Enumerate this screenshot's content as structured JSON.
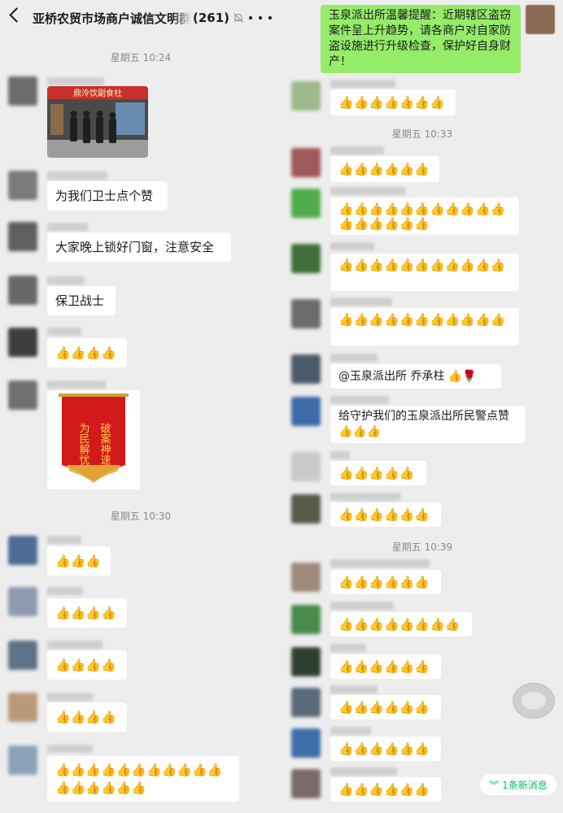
{
  "header": {
    "title": "亚桥农贸市场商户诚信文明群",
    "count": "(261)",
    "icons": {
      "back": "back-chevron-icon",
      "mute": "mute-bell-icon",
      "more": "more-dots-icon"
    }
  },
  "times": {
    "left_1": "星期五 10:24",
    "left_2": "星期五 10:30",
    "right_1": "星期五 10:33",
    "right_2": "星期五 10:39"
  },
  "messages_left": {
    "m1_image": "police-photo",
    "m2": "为我们卫士点个赞",
    "m3": "大家晚上锁好门窗，注意安全",
    "m4": "保卫战士",
    "m5": "👍👍👍👍",
    "m6_image": "banner-photo",
    "m7": "👍👍👍",
    "m8": "👍👍👍👍",
    "m9": "👍👍👍👍",
    "m10": "👍👍👍👍",
    "m11": "👍👍👍👍👍👍👍👍👍👍👍👍👍👍👍👍👍"
  },
  "photo_sign": "鼎泠饮副食社",
  "banner_text": {
    "line1": "破案神速",
    "line2": "为民解忧"
  },
  "messages_right": {
    "r0": "玉泉派出所温馨提醒：近期辖区盗窃案件呈上升趋势，请各商户对自家防盗设施进行升级检查，保护好自身财产！",
    "r1": "👍👍👍👍👍👍👍",
    "r2": "👍👍👍👍👍👍",
    "r3": "👍👍👍👍👍👍👍👍👍👍👍👍👍👍👍👍👍",
    "r4": "👍👍👍👍👍👍👍👍👍👍👍",
    "r5": "👍👍👍👍👍👍👍👍👍👍👍",
    "r6": "@玉泉派出所  乔承柱 👍🌹",
    "r7": "给守护我们的玉泉派出所民警点赞👍👍👍",
    "r8": "👍👍👍👍👍",
    "r9": "👍👍👍👍👍👍",
    "r10": "👍👍👍👍👍👍",
    "r11": "👍👍👍👍👍👍👍👍",
    "r12": "👍👍👍👍👍👍",
    "r13": "👍👍👍👍👍👍",
    "r14": "👍👍👍👍👍👍",
    "r15": "👍👍👍👍👍👍"
  },
  "new_message_pill": "︾ 1条新消息",
  "colors": {
    "background": "#ededed",
    "bubble_self": "#95ec69",
    "bubble_other": "#ffffff",
    "accent": "#07c160"
  }
}
